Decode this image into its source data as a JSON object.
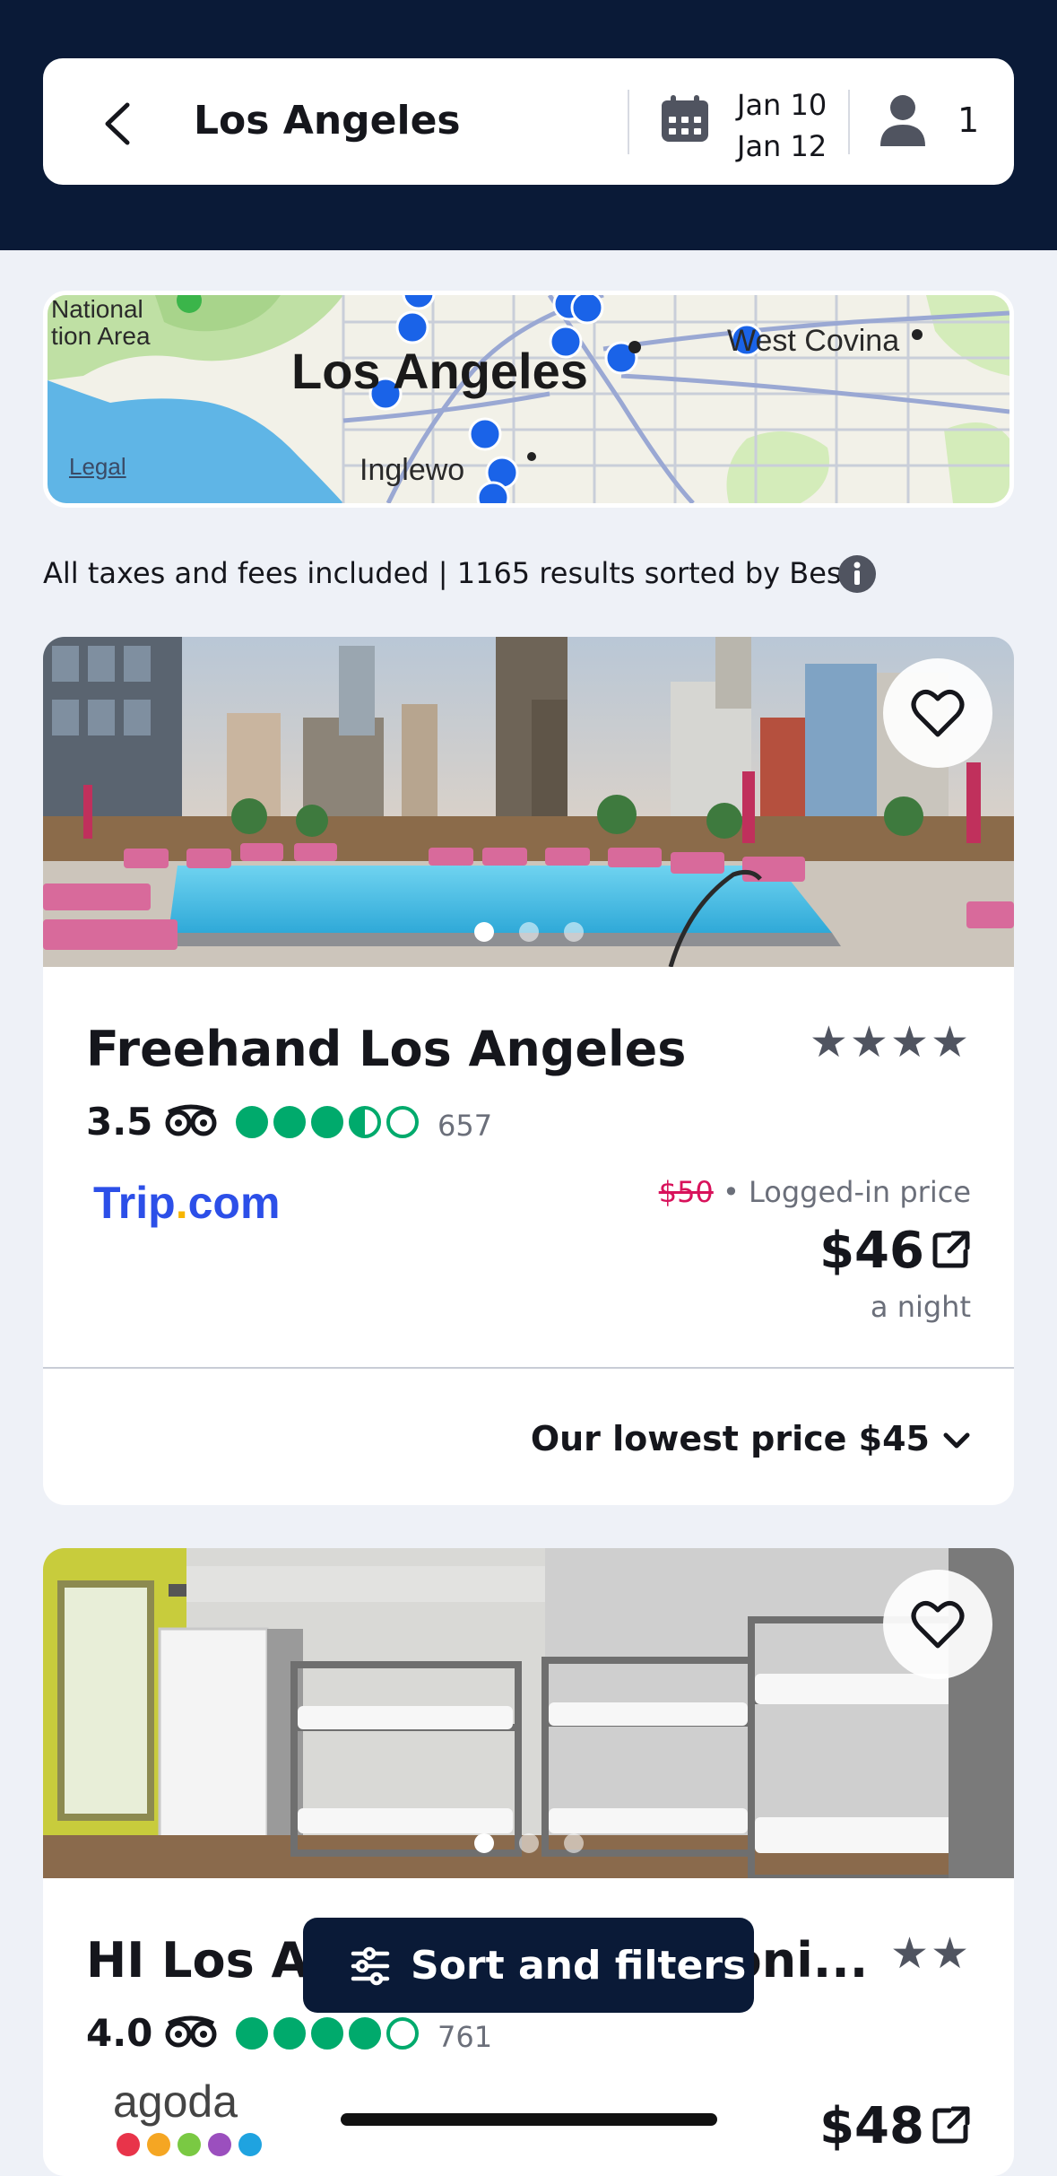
{
  "header": {
    "city": "Los Angeles",
    "checkin": "Jan 10",
    "checkout": "Jan 12",
    "guests": "1"
  },
  "map": {
    "labels": [
      "National",
      "tion Area",
      "Los Angeles",
      "West Covina",
      "Inglewo",
      "Legal"
    ]
  },
  "results_info": "All taxes and fees included | 1165 results sorted by Best",
  "hotels": [
    {
      "name": "Freehand Los Angeles",
      "stars": "★★★★",
      "rating": "3.5",
      "reviews": "657",
      "bubbles": 3.5,
      "provider": "Trip.com",
      "old_price": "$50",
      "price_note": "Logged-in price",
      "price": "$46",
      "per": "a night",
      "lowest_price": "Our lowest price $45"
    },
    {
      "name": "HI Los Angeles Santa Moni...",
      "stars": "★★",
      "rating": "4.0",
      "reviews": "761",
      "bubbles": 4.0,
      "provider": "agoda",
      "price": "$48"
    }
  ],
  "sort_button": "Sort and filters",
  "icons": {
    "back": "back-arrow-icon",
    "calendar": "calendar-icon",
    "guest": "person-icon",
    "info": "info-icon",
    "favorite": "heart-icon",
    "external": "external-link-icon",
    "chevron": "chevron-down-icon",
    "filters": "sliders-icon"
  },
  "colors": {
    "header_bg": "#0a1a37",
    "tripadvisor_green": "#00aa6c",
    "strike_price": "#d8125b",
    "map_pin": "#1a63e8"
  }
}
